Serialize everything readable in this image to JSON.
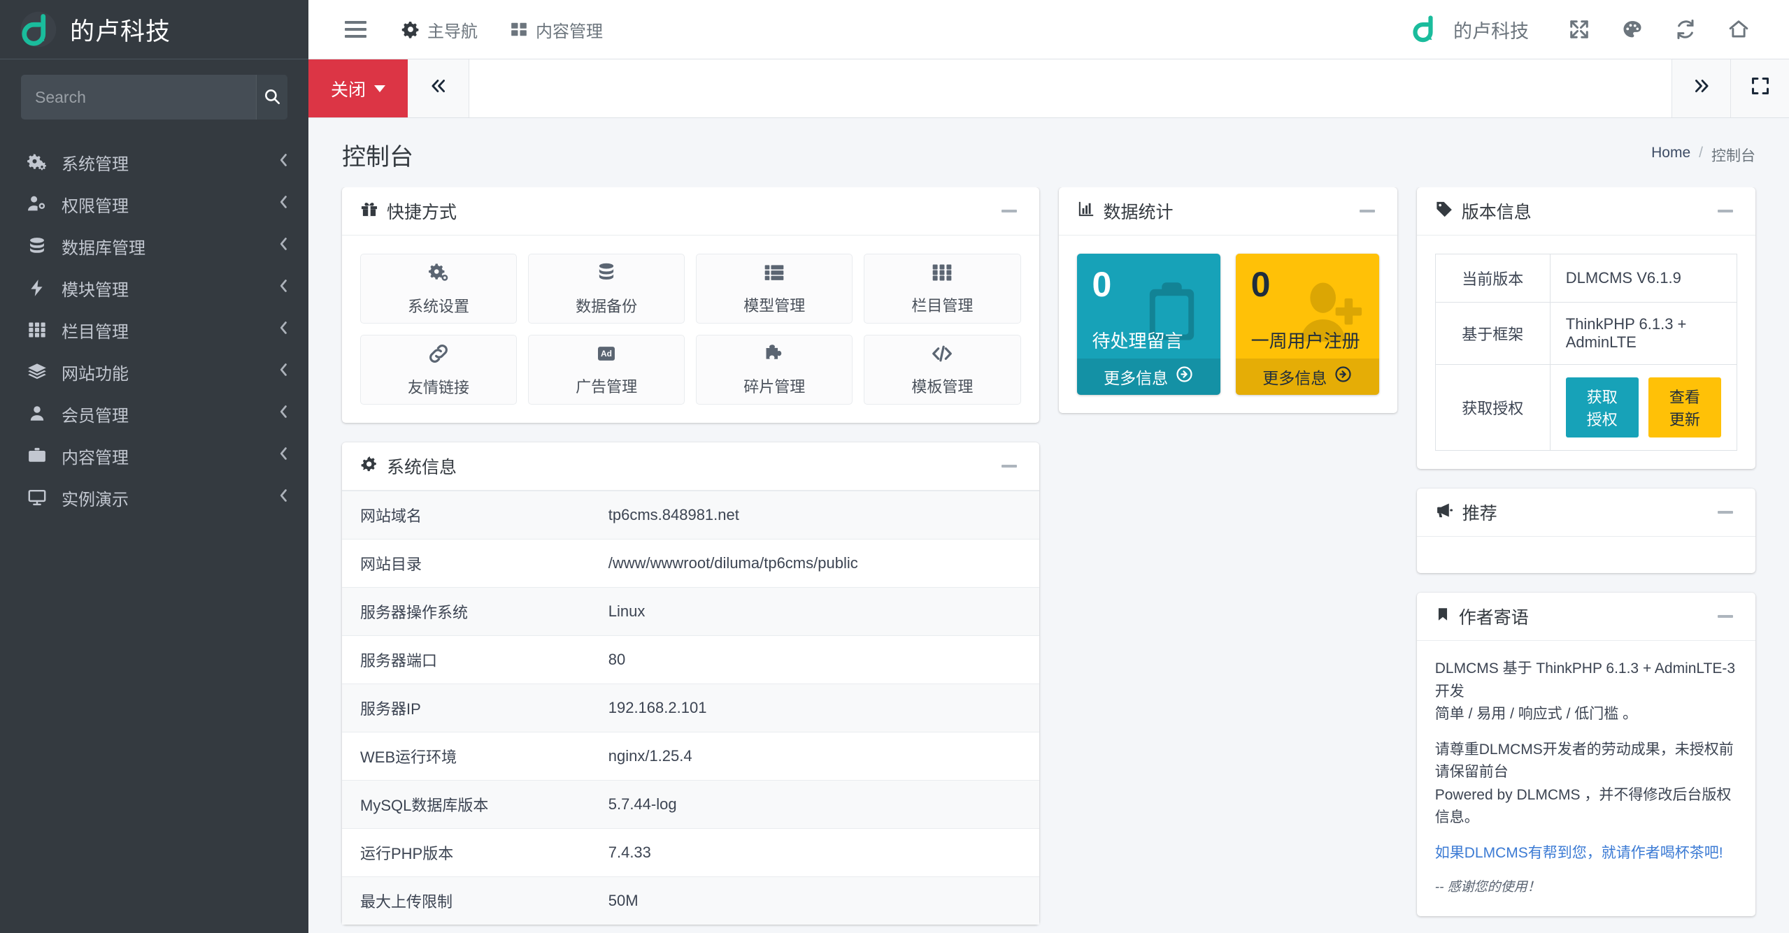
{
  "sidebar": {
    "brand_title": "的卢科技",
    "brand_logo_icon": "diluma-d-logo",
    "search": {
      "placeholder": "Search",
      "value": "",
      "icon": "search-icon"
    },
    "items": [
      {
        "label": "系统管理",
        "icon": "cogs-icon",
        "arrow": "chevron-left-icon"
      },
      {
        "label": "权限管理",
        "icon": "user-cog-icon",
        "arrow": "chevron-left-icon"
      },
      {
        "label": "数据库管理",
        "icon": "database-icon",
        "arrow": "chevron-left-icon"
      },
      {
        "label": "模块管理",
        "icon": "bolt-icon",
        "arrow": "chevron-left-icon"
      },
      {
        "label": "栏目管理",
        "icon": "th-grid-icon",
        "arrow": "chevron-left-icon"
      },
      {
        "label": "网站功能",
        "icon": "layers-icon",
        "arrow": "chevron-left-icon"
      },
      {
        "label": "会员管理",
        "icon": "user-icon",
        "arrow": "chevron-left-icon"
      },
      {
        "label": "内容管理",
        "icon": "briefcase-icon",
        "arrow": "chevron-left-icon"
      },
      {
        "label": "实例演示",
        "icon": "desktop-icon",
        "arrow": "chevron-left-icon"
      }
    ]
  },
  "topbar": {
    "menu_toggle_icon": "hamburger-icon",
    "links": [
      {
        "label": "主导航",
        "icon": "gear-icon"
      },
      {
        "label": "内容管理",
        "icon": "th-large-icon"
      }
    ],
    "brand_text": "的卢科技",
    "brand_logo_icon": "diluma-d-logo",
    "icons": [
      {
        "name": "expand-arrows-icon"
      },
      {
        "name": "palette-icon"
      },
      {
        "name": "refresh-icon"
      },
      {
        "name": "home-icon"
      }
    ]
  },
  "tabbar": {
    "close_label": "关闭",
    "close_caret_icon": "caret-down-icon",
    "prev_icon": "angle-double-left-icon",
    "next_icon": "angle-double-right-icon",
    "fullscreen_icon": "expand-frame-icon"
  },
  "page": {
    "title": "控制台",
    "breadcrumb": {
      "home": "Home",
      "separator": "/",
      "current": "控制台"
    }
  },
  "shortcuts": {
    "title": "快捷方式",
    "title_icon": "gift-icon",
    "collapse_icon": "minus-icon",
    "tiles": [
      {
        "label": "系统设置",
        "icon": "cogs-icon"
      },
      {
        "label": "数据备份",
        "icon": "database-icon"
      },
      {
        "label": "模型管理",
        "icon": "th-list-icon"
      },
      {
        "label": "栏目管理",
        "icon": "th-grid-icon"
      },
      {
        "label": "友情链接",
        "icon": "link-icon"
      },
      {
        "label": "广告管理",
        "icon": "ad-icon"
      },
      {
        "label": "碎片管理",
        "icon": "puzzle-piece-icon"
      },
      {
        "label": "模板管理",
        "icon": "code-icon"
      }
    ]
  },
  "stats": {
    "title": "数据统计",
    "title_icon": "chart-bar-icon",
    "collapse_icon": "minus-icon",
    "boxes": [
      {
        "value": "0",
        "label": "待处理留言",
        "more_label": "更多信息",
        "more_icon": "arrow-circle-right-icon",
        "bg_icon": "clipboard-icon",
        "color": "#17a2b8"
      },
      {
        "value": "0",
        "label": "一周用户注册",
        "more_label": "更多信息",
        "more_icon": "arrow-circle-right-icon",
        "bg_icon": "user-plus-icon",
        "color": "#ffc107"
      }
    ]
  },
  "sysinfo": {
    "title": "系统信息",
    "title_icon": "gear-icon",
    "collapse_icon": "minus-icon",
    "rows": [
      {
        "key": "网站域名",
        "value": "tp6cms.848981.net"
      },
      {
        "key": "网站目录",
        "value": "/www/wwwroot/diluma/tp6cms/public"
      },
      {
        "key": "服务器操作系统",
        "value": "Linux"
      },
      {
        "key": "服务器端口",
        "value": "80"
      },
      {
        "key": "服务器IP",
        "value": "192.168.2.101"
      },
      {
        "key": "WEB运行环境",
        "value": "nginx/1.25.4"
      },
      {
        "key": "MySQL数据库版本",
        "value": "5.7.44-log"
      },
      {
        "key": "运行PHP版本",
        "value": "7.4.33"
      },
      {
        "key": "最大上传限制",
        "value": "50M"
      }
    ]
  },
  "version": {
    "title": "版本信息",
    "title_icon": "tag-icon",
    "collapse_icon": "minus-icon",
    "rows": [
      {
        "key": "当前版本",
        "value": "DLMCMS V6.1.9"
      },
      {
        "key": "基于框架",
        "value": "ThinkPHP 6.1.3 + AdminLTE"
      }
    ],
    "license_label": "获取授权",
    "license_button": "获取授权",
    "update_button": "查看更新"
  },
  "recommend": {
    "title": "推荐",
    "title_icon": "bullhorn-icon",
    "collapse_icon": "minus-icon"
  },
  "author": {
    "title": "作者寄语",
    "title_icon": "bookmark-icon",
    "collapse_icon": "minus-icon",
    "line1": "DLMCMS 基于 ThinkPHP 6.1.3 + AdminLTE-3 开发",
    "line2": "简单 / 易用 / 响应式 / 低门槛 。",
    "line3": "请尊重DLMCMS开发者的劳动成果，未授权前请保留前台",
    "line4": "Powered by DLMCMS ，并不得修改后台版权信息。",
    "link": "如果DLMCMS有帮到您，就请作者喝杯茶吧!",
    "thanks": "-- 感谢您的使用！"
  },
  "colors": {
    "sidebar_bg": "#343a40",
    "brand_green": "#1abc9c",
    "accent_red": "#dc3545",
    "teal": "#17a2b8",
    "yellow": "#ffc107",
    "content_bg": "#f4f6f9"
  }
}
